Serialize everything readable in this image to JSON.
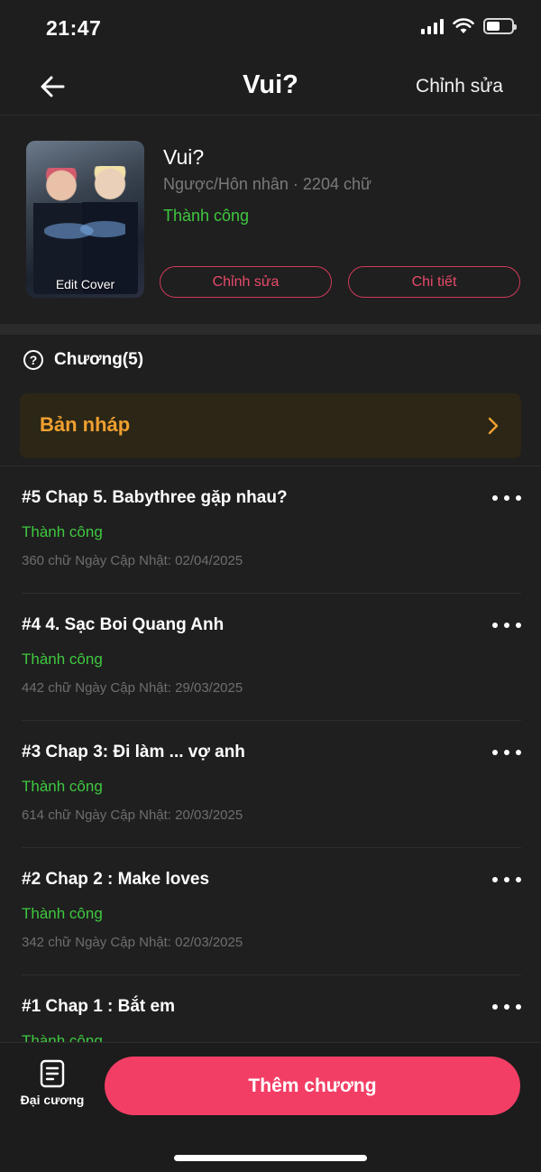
{
  "status_bar": {
    "time": "21:47",
    "battery_level": 0.55
  },
  "nav": {
    "back_icon": "arrow-left-icon",
    "title": "Vui?",
    "edit_label": "Chỉnh sửa"
  },
  "book": {
    "cover_label": "Edit Cover",
    "title": "Vui?",
    "meta": "Ngược/Hôn nhân · 2204 chữ",
    "status": "Thành công",
    "edit_button": "Chỉnh sửa",
    "detail_button": "Chi tiết"
  },
  "chapters": {
    "help_icon": "?",
    "header": "Chương(5)",
    "draft_label": "Bản nháp",
    "items": [
      {
        "title": "#5 Chap 5. Babythree gặp nhau?",
        "status": "Thành công",
        "meta": "360 chữ Ngày Cập Nhật: 02/04/2025"
      },
      {
        "title": "#4 4. Sạc Boi Quang Anh",
        "status": "Thành công",
        "meta": "442 chữ Ngày Cập Nhật: 29/03/2025"
      },
      {
        "title": "#3 Chap 3: Đi làm ... vợ anh",
        "status": "Thành công",
        "meta": "614 chữ Ngày Cập Nhật: 20/03/2025"
      },
      {
        "title": "#2 Chap 2 : Make loves",
        "status": "Thành công",
        "meta": "342 chữ Ngày Cập Nhật: 02/03/2025"
      },
      {
        "title": "#1 Chap 1 : Bắt em",
        "status": "Thành công",
        "meta": ""
      }
    ]
  },
  "bottom": {
    "outline_label": "Đại cương",
    "add_chapter_label": "Thêm chương"
  },
  "colors": {
    "accent": "#f23e65",
    "success": "#3fc83f",
    "draft": "#f0a030",
    "background": "#1f1f1f"
  }
}
